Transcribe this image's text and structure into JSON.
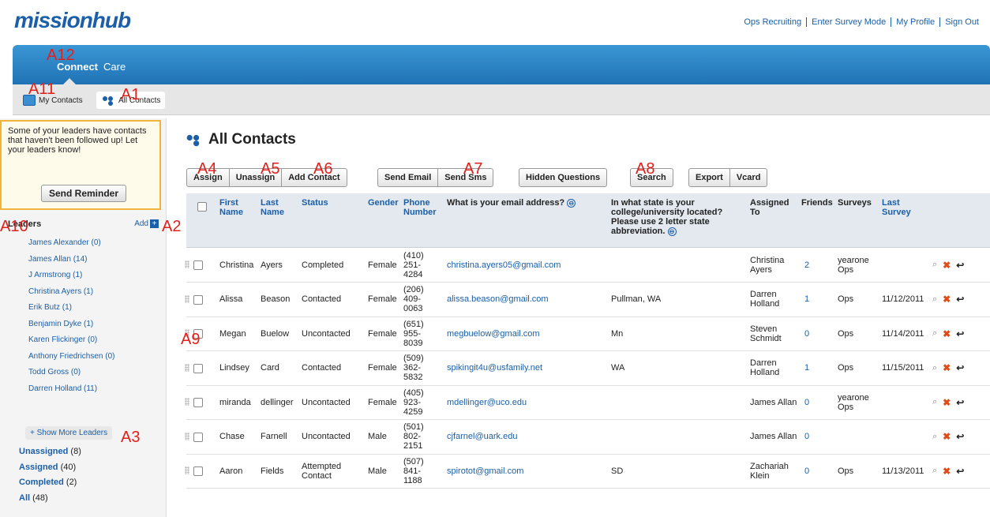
{
  "header": {
    "logo": "missionhub",
    "links": [
      "Ops Recruiting",
      "Enter Survey Mode",
      "My Profile",
      "Sign Out"
    ]
  },
  "nav": {
    "tabs": [
      "Connect",
      "Care"
    ],
    "subtabs": [
      "My Contacts",
      "All Contacts"
    ]
  },
  "sidebar": {
    "reminder_text": "Some of your leaders have contacts that haven't been followed up! Let your leaders know!",
    "reminder_button": "Send Reminder",
    "leaders_title": "Leaders",
    "add_label": "Add",
    "add_icon": "+",
    "leaders": [
      "James Alexander (0)",
      "James Allan (14)",
      "J Armstrong (1)",
      "Christina Ayers (1)",
      "Erik Butz (1)",
      "Benjamin Dyke (1)",
      "Karen Flickinger (0)",
      "Anthony Friedrichsen (0)",
      "Todd Gross (0)",
      "Darren Holland (11)"
    ],
    "show_more": "+ Show More Leaders",
    "groups": [
      {
        "name": "Unassigned",
        "count": "(8)"
      },
      {
        "name": "Assigned",
        "count": "(40)"
      },
      {
        "name": "Completed",
        "count": "(2)"
      },
      {
        "name": "All",
        "count": "(48)"
      }
    ]
  },
  "main": {
    "title": "All Contacts",
    "toolbar": {
      "assign": "Assign",
      "unassign": "Unassign",
      "add_contact": "Add Contact",
      "send_email": "Send Email",
      "send_sms": "Send Sms",
      "hidden_questions": "Hidden Questions",
      "search": "Search",
      "export": "Export",
      "vcard": "Vcard"
    },
    "columns": {
      "first_name": "First Name",
      "last_name": "Last Name",
      "status": "Status",
      "gender": "Gender",
      "phone": "Phone Number",
      "email_q": "What is your email address?",
      "state_q": "In what state is your college/university located? Please use 2 letter state abbreviation.",
      "assigned_to": "Assigned To",
      "friends": "Friends",
      "surveys": "Surveys",
      "last_survey": "Last Survey",
      "collapse_icon": "⊖"
    },
    "rows": [
      {
        "first": "Christina",
        "last": "Ayers",
        "status": "Completed",
        "gender": "Female",
        "phone": "(410) 251- 4284",
        "email": "christina.ayers05@gmail.com",
        "state": "",
        "assigned": "Christina Ayers",
        "friends": "2",
        "surveys": "yearone Ops",
        "last_survey": ""
      },
      {
        "first": "Alissa",
        "last": "Beason",
        "status": "Contacted",
        "gender": "Female",
        "phone": "(206) 409- 0063",
        "email": "alissa.beason@gmail.com",
        "state": "Pullman, WA",
        "assigned": "Darren Holland",
        "friends": "1",
        "surveys": "Ops",
        "last_survey": "11/12/2011"
      },
      {
        "first": "Megan",
        "last": "Buelow",
        "status": "Uncontacted",
        "gender": "Female",
        "phone": "(651) 955- 8039",
        "email": "megbuelow@gmail.com",
        "state": "Mn",
        "assigned": "Steven Schmidt",
        "friends": "0",
        "surveys": "Ops",
        "last_survey": "11/14/2011"
      },
      {
        "first": "Lindsey",
        "last": "Card",
        "status": "Contacted",
        "gender": "Female",
        "phone": "(509) 362- 5832",
        "email": "spikingit4u@usfamily.net",
        "state": "WA",
        "assigned": "Darren Holland",
        "friends": "1",
        "surveys": "Ops",
        "last_survey": "11/15/2011"
      },
      {
        "first": "miranda",
        "last": "dellinger",
        "status": "Uncontacted",
        "gender": "Female",
        "phone": "(405) 923- 4259",
        "email": "mdellinger@uco.edu",
        "state": "",
        "assigned": "James Allan",
        "friends": "0",
        "surveys": "yearone Ops",
        "last_survey": ""
      },
      {
        "first": "Chase",
        "last": "Farnell",
        "status": "Uncontacted",
        "gender": "Male",
        "phone": "(501) 802- 2151",
        "email": "cjfarnel@uark.edu",
        "state": "",
        "assigned": "James Allan",
        "friends": "0",
        "surveys": "",
        "last_survey": ""
      },
      {
        "first": "Aaron",
        "last": "Fields",
        "status": "Attempted Contact",
        "gender": "Male",
        "phone": "(507) 841- 1188",
        "email": "spirotot@gmail.com",
        "state": "SD",
        "assigned": "Zachariah Klein",
        "friends": "0",
        "surveys": "Ops",
        "last_survey": "11/13/2011"
      }
    ]
  },
  "annotations": [
    "A1",
    "A2",
    "A3",
    "A4",
    "A5",
    "A6",
    "A7",
    "A8",
    "A9",
    "A10",
    "A11",
    "A12"
  ]
}
